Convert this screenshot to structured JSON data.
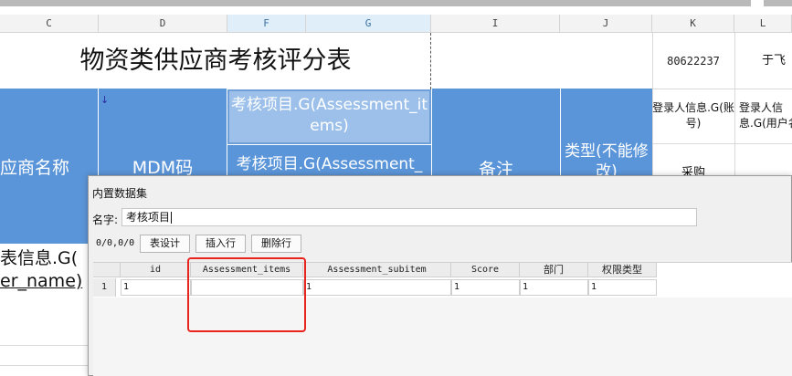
{
  "columns": [
    "C",
    "D",
    "F",
    "G",
    "I",
    "J",
    "K",
    "L"
  ],
  "sheet": {
    "title": "物资类供应商考核评分表",
    "k_value": "80622237",
    "l_value": "于飞",
    "assessment_item_top": "考核项目.G(Assessment_items)",
    "assessment_item_bottom": "考核项目.G(Assessment_",
    "supplier_name": "应商名称",
    "mdm_code": "MDM码",
    "remarks": "备注",
    "type_label": "类型(不能修改)",
    "login_account": "登录人信息.G(账号)",
    "login_username": "登录人信息.G(用户名",
    "purchase": "采购",
    "emp_info": "表信息.G(",
    "emp_name": "er_name)"
  },
  "dialog": {
    "title": "内置数据集",
    "name_label": "名字:",
    "name_value": "考核项目",
    "counter": "0/0,0/0",
    "buttons": {
      "design": "表设计",
      "insert": "插入行",
      "delete": "删除行"
    },
    "table": {
      "headers": [
        "id",
        "Assessment_items",
        "Assessment_subitem",
        "Score",
        "部门",
        "权限类型"
      ],
      "rows": [
        {
          "num": "1",
          "cells": [
            "1",
            "",
            "1",
            "1",
            "1",
            "1"
          ]
        }
      ]
    }
  },
  "colors": {
    "header_blue": "#5b95d9",
    "selected_blue": "#9cc0ea",
    "highlight_red": "#e8241c"
  }
}
